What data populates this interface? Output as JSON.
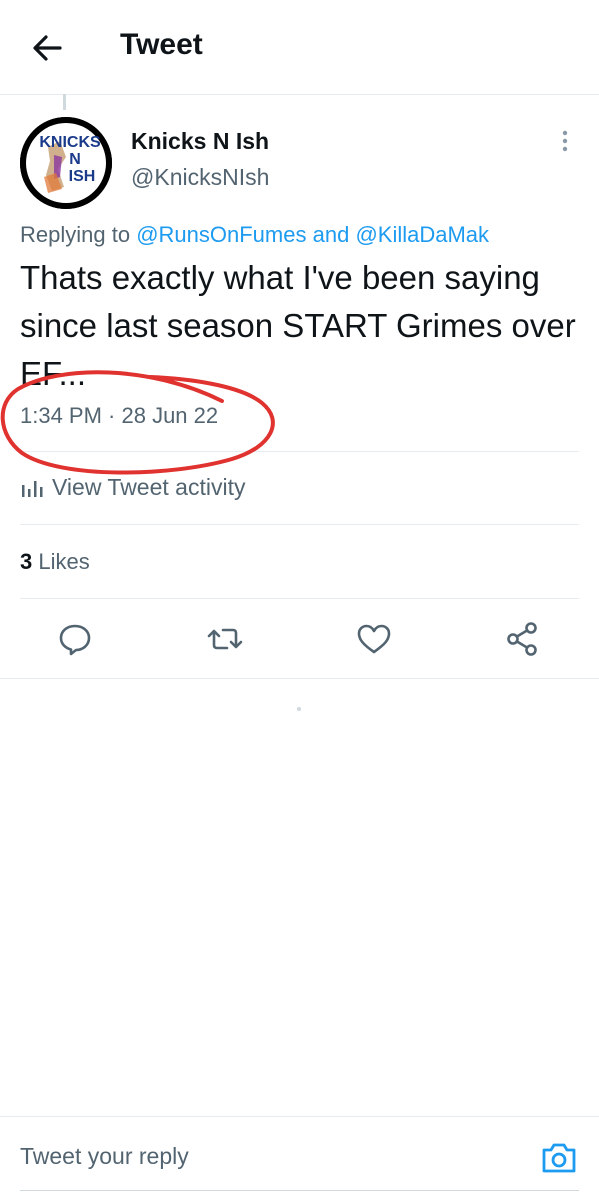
{
  "header": {
    "title": "Tweet"
  },
  "tweet": {
    "author_name": "Knicks N Ish",
    "handle": "@KnicksNIsh",
    "replying_prefix": "Replying to",
    "reply_user_1": "@RunsOnFumes",
    "reply_and": "and",
    "reply_user_2": "@KillaDaMak",
    "text": "Thats exactly what I've been saying since last season START Grimes over EF...",
    "timestamp": "1:34 PM · 28 Jun 22",
    "activity_label": "View Tweet activity",
    "likes_count": "3",
    "likes_label": "Likes"
  },
  "avatar_logo": {
    "line1": "KNICKS",
    "line2": "N",
    "line3": "ISH"
  },
  "reply_box": {
    "placeholder": "Tweet your reply"
  },
  "colors": {
    "link": "#1d9bf0",
    "secondary": "#536471",
    "annotation": "#e0322f"
  },
  "icons": [
    "back-arrow-icon",
    "more-vertical-icon",
    "bar-chart-icon",
    "reply-icon",
    "retweet-icon",
    "like-icon",
    "share-icon",
    "camera-icon"
  ]
}
